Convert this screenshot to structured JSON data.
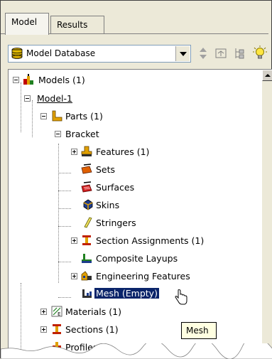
{
  "tabs": [
    {
      "label": "Model",
      "active": true
    },
    {
      "label": "Results",
      "active": false
    }
  ],
  "toolbar": {
    "database_label": "Model Database",
    "icons": [
      "up-down-arrows-icon",
      "expand-icon",
      "tree-collapse-icon",
      "lightbulb-icon"
    ]
  },
  "tree": {
    "models": "Models (1)",
    "model1": "Model-1",
    "parts": "Parts (1)",
    "bracket": "Bracket",
    "features": "Features (1)",
    "sets": "Sets",
    "surfaces": "Surfaces",
    "skins": "Skins",
    "stringers": "Stringers",
    "section_assignments": "Section Assignments (1)",
    "composite_layups": "Composite Layups",
    "engineering_features": "Engineering Features",
    "mesh": "Mesh (Empty)",
    "materials": "Materials (1)",
    "sections": "Sections (1)",
    "profiles": "Profiles"
  },
  "tooltip": "Mesh",
  "colors": {
    "selection": "#0a246a",
    "tooltip_bg": "#ffffe1",
    "panel_bg": "#ece9d8"
  }
}
